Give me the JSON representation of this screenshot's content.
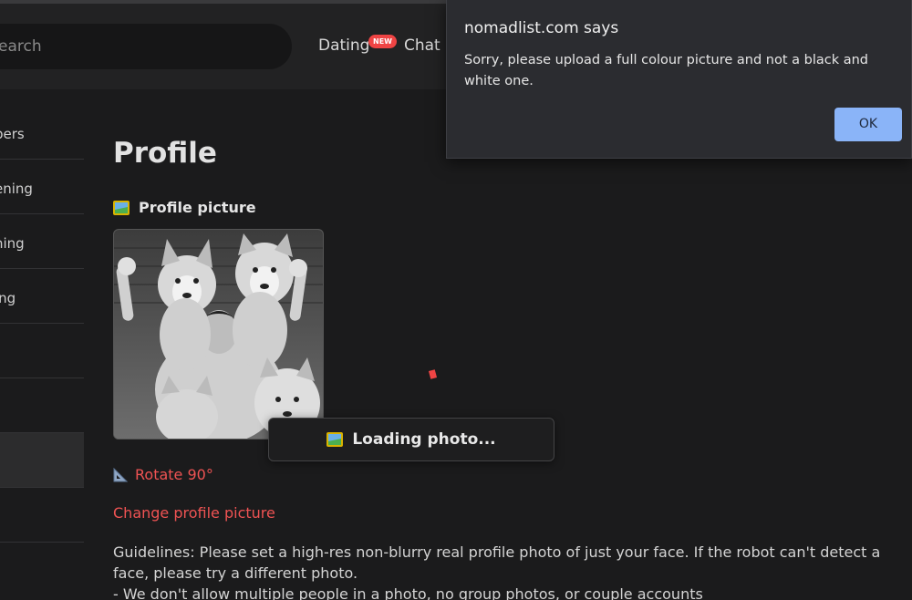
{
  "header": {
    "search_placeholder": "earch",
    "nav": [
      {
        "label": "Dating",
        "badge": "NEW"
      },
      {
        "label": "Chat"
      }
    ]
  },
  "sidebar": {
    "items": [
      {
        "label": "bers"
      },
      {
        "label": "ening"
      },
      {
        "label": "ning"
      },
      {
        "label": "ing"
      },
      {
        "label": ""
      },
      {
        "label": ""
      },
      {
        "label": "",
        "active": true
      },
      {
        "label": ""
      }
    ]
  },
  "main": {
    "title": "Profile",
    "picture_section_label": "Profile picture",
    "loading_text": "Loading photo...",
    "rotate_label": "Rotate 90°",
    "change_label": "Change profile picture",
    "guidelines_line1": "Guidelines: Please set a high-res non-blurry real profile photo of just your face. If the robot can't detect a face, please try a different photo.",
    "guidelines_line2": "- We don't allow multiple people in a photo, no group photos, or couple accounts"
  },
  "dialog": {
    "title": "nomadlist.com says",
    "message": "Sorry, please upload a full colour picture and not a black and white one.",
    "ok_label": "OK"
  },
  "colors": {
    "accent_red": "#ef5353",
    "dialog_button": "#8ab4f8",
    "background": "#1b1b1c"
  }
}
